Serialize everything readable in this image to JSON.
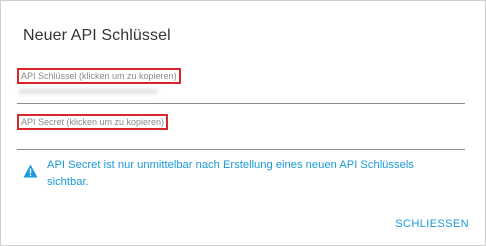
{
  "dialog": {
    "title": "Neuer API Schlüssel",
    "close_label": "SCHLIESSEN"
  },
  "fields": {
    "api_key": {
      "label": "API Schlüssel (klicken um zu kopieren)",
      "value": "••••••••••••••••••••••••••••••••••••"
    },
    "api_secret": {
      "label": "API Secret (klicken um zu kopieren)",
      "value": ""
    }
  },
  "notice": {
    "text": "API Secret ist nur unmittelbar nach Erstellung eines neuen API Schlüssels sichtbar.",
    "icon": "warning-icon"
  },
  "colors": {
    "accent": "#1a9ad6",
    "highlight": "#d9262b"
  }
}
